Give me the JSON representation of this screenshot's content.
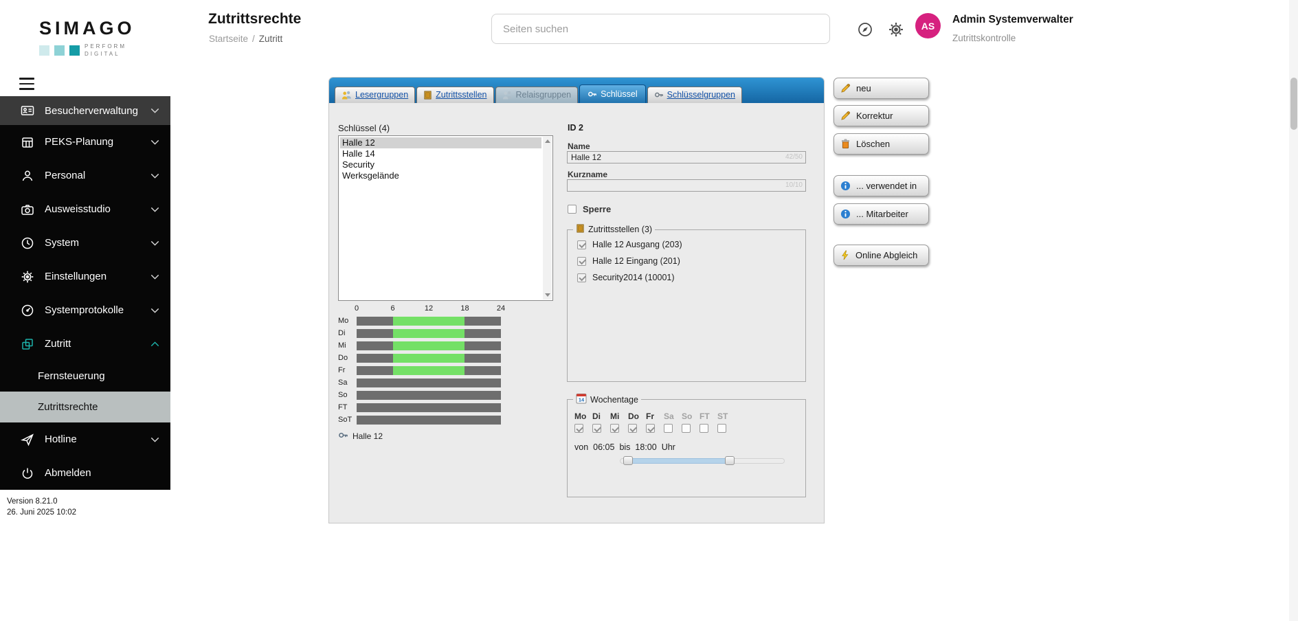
{
  "sidebar": {
    "logo": {
      "word": "SIMAGO",
      "tag_line1": "PERFORM",
      "tag_line2": "DIGITAL"
    },
    "items": [
      {
        "label": "Besucherverwaltung"
      },
      {
        "label": "PEKS-Planung"
      },
      {
        "label": "Personal"
      },
      {
        "label": "Ausweisstudio"
      },
      {
        "label": "System"
      },
      {
        "label": "Einstellungen"
      },
      {
        "label": "Systemprotokolle"
      },
      {
        "label": "Zutritt"
      },
      {
        "label": "Hotline"
      },
      {
        "label": "Abmelden"
      }
    ],
    "subitems": [
      {
        "label": "Fernsteuerung"
      },
      {
        "label": "Zutrittsrechte",
        "active": true
      }
    ],
    "version": "Version 8.21.0",
    "date": "26. Juni 2025 10:02"
  },
  "header": {
    "title": "Zutrittsrechte",
    "breadcrumb": {
      "home": "Startseite",
      "sep": "/",
      "current": "Zutritt"
    },
    "search_placeholder": "Seiten suchen",
    "user": {
      "initials": "AS",
      "name": "Admin Systemverwalter",
      "role": "Zutrittskontrolle"
    }
  },
  "tabs": [
    {
      "label": "Lesergruppen"
    },
    {
      "label": "Zutrittsstellen"
    },
    {
      "label": "Relaisgruppen",
      "disabled": true
    },
    {
      "label": "Schlüssel",
      "active": true
    },
    {
      "label": "Schlüsselgruppen"
    }
  ],
  "key_list": {
    "label": "Schlüssel (4)",
    "items": [
      "Halle 12",
      "Halle 14",
      "Security",
      "Werksgelände"
    ],
    "selected": "Halle 12"
  },
  "chart_data": {
    "type": "bar",
    "subtype": "weekly-access-schedule",
    "categories": [
      "Mo",
      "Di",
      "Mi",
      "Do",
      "Fr",
      "Sa",
      "So",
      "FT",
      "SoT"
    ],
    "x_ticks": [
      0,
      6,
      12,
      18,
      24
    ],
    "xlim": [
      0,
      24
    ],
    "series": [
      {
        "name": "Halle 12",
        "start_label": "06:05",
        "end_label": "18:00",
        "intervals": {
          "Mo": [
            6.08,
            18
          ],
          "Di": [
            6.08,
            18
          ],
          "Mi": [
            6.08,
            18
          ],
          "Do": [
            6.08,
            18
          ],
          "Fr": [
            6.08,
            18
          ],
          "Sa": null,
          "So": null,
          "FT": null,
          "SoT": null
        }
      }
    ],
    "active_color": "#74e066",
    "track_color": "#6e6e6e",
    "legend": [
      "Halle 12"
    ]
  },
  "details": {
    "id_text": "ID 2",
    "name": {
      "label": "Name",
      "value": "Halle 12",
      "counter": "42/50"
    },
    "kurzname": {
      "label": "Kurzname",
      "value": "",
      "counter": "10/10"
    },
    "sperre": {
      "label": "Sperre",
      "checked": false
    },
    "stations": {
      "label": "Zutrittsstellen (3)",
      "items": [
        {
          "label": "Halle 12 Ausgang (203)",
          "checked": true
        },
        {
          "label": "Halle 12 Eingang (201)",
          "checked": true
        },
        {
          "label": "Security2014 (10001)",
          "checked": true
        }
      ]
    },
    "wochentage": {
      "label": "Wochentage",
      "icon_day": "14",
      "days": [
        {
          "label": "Mo",
          "checked": true,
          "muted": false
        },
        {
          "label": "Di",
          "checked": true,
          "muted": false
        },
        {
          "label": "Mi",
          "checked": true,
          "muted": false
        },
        {
          "label": "Do",
          "checked": true,
          "muted": false
        },
        {
          "label": "Fr",
          "checked": true,
          "muted": false
        },
        {
          "label": "Sa",
          "checked": false,
          "muted": true
        },
        {
          "label": "So",
          "checked": false,
          "muted": true
        },
        {
          "label": "FT",
          "checked": false,
          "muted": true
        },
        {
          "label": "ST",
          "checked": false,
          "muted": true
        }
      ],
      "time": {
        "von": "von",
        "start": "06:05",
        "bis": "bis",
        "end": "18:00",
        "uhr": "Uhr"
      }
    }
  },
  "actions": [
    {
      "label": "neu"
    },
    {
      "label": "Korrektur"
    },
    {
      "label": "Löschen"
    },
    {
      "label": "... verwendet in"
    },
    {
      "label": "... Mitarbeiter"
    },
    {
      "label": "Online Abgleich"
    }
  ]
}
